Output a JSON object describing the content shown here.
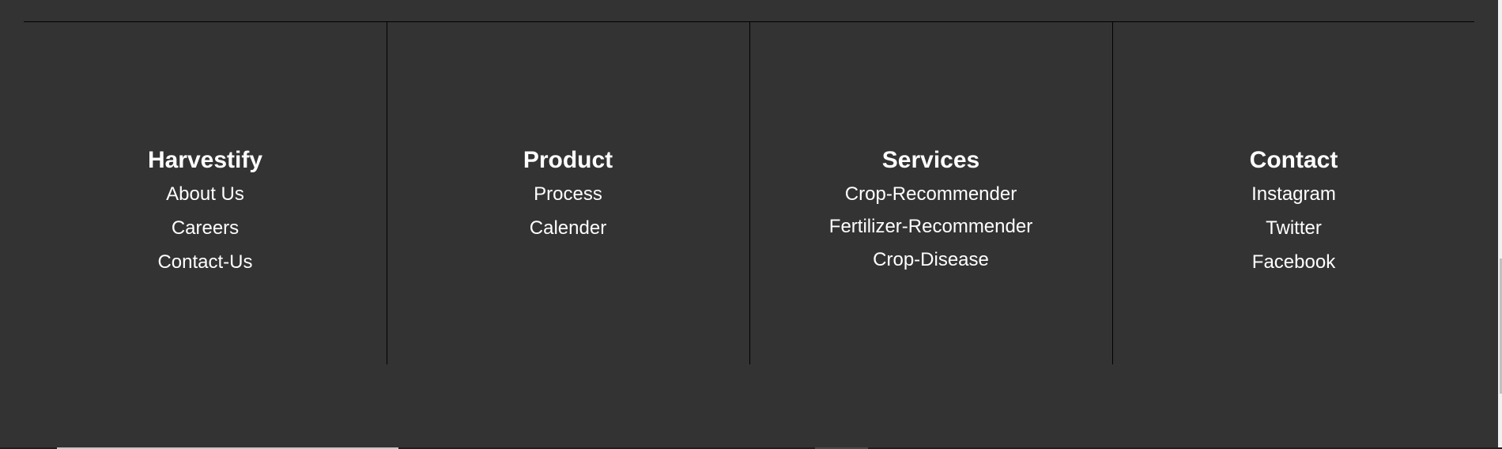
{
  "footer": {
    "columns": [
      {
        "heading": "Harvestify",
        "links": [
          "About Us",
          "Careers",
          "Contact-Us"
        ]
      },
      {
        "heading": "Product",
        "links": [
          "Process",
          "Calender"
        ]
      },
      {
        "heading": "Services",
        "links": [
          "Crop-Recommender",
          "Fertilizer-Recommender",
          "Crop-Disease"
        ]
      },
      {
        "heading": "Contact",
        "links": [
          "Instagram",
          "Twitter",
          "Facebook"
        ]
      }
    ]
  },
  "colors": {
    "background": "#333333",
    "text": "#ffffff",
    "divider": "#000000"
  }
}
